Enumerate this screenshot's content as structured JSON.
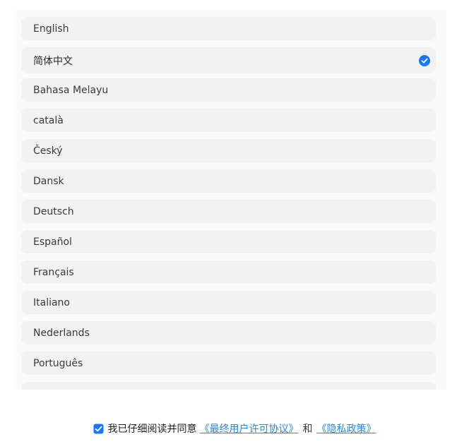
{
  "languages": [
    {
      "label": "English",
      "selected": false
    },
    {
      "label": "简体中文",
      "selected": true
    },
    {
      "label": "Bahasa Melayu",
      "selected": false
    },
    {
      "label": "català",
      "selected": false
    },
    {
      "label": "Český",
      "selected": false
    },
    {
      "label": "Dansk",
      "selected": false
    },
    {
      "label": "Deutsch",
      "selected": false
    },
    {
      "label": "Español",
      "selected": false
    },
    {
      "label": "Français",
      "selected": false
    },
    {
      "label": "Italiano",
      "selected": false
    },
    {
      "label": "Nederlands",
      "selected": false
    },
    {
      "label": "Português",
      "selected": false
    },
    {
      "label": "",
      "selected": false
    }
  ],
  "footer": {
    "agree_checked": true,
    "agree_text": "我已仔细阅读并同意",
    "eula_link": "《最终用户许可协议》",
    "and_text": "和",
    "privacy_link": "《隐私政策》"
  },
  "colors": {
    "accent": "#2f86d6",
    "item_bg": "#f2f2f2",
    "panel_bg": "#fafafa"
  }
}
